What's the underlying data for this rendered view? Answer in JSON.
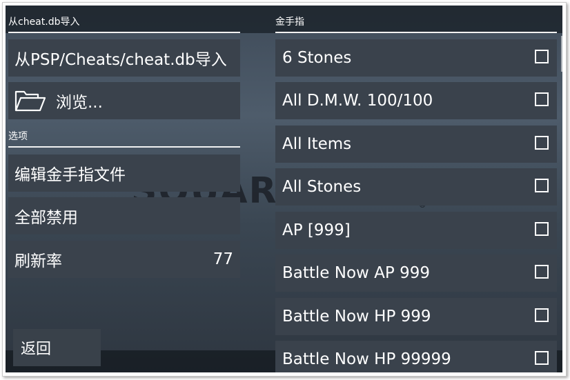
{
  "left": {
    "import_section": {
      "header": "从cheat.db导入",
      "import_button": "从PSP/Cheats/cheat.db导入",
      "browse_button": "浏览..."
    },
    "options_section": {
      "header": "选项",
      "edit_button": "编辑金手指文件",
      "disable_all_button": "全部禁用",
      "refresh_rate": {
        "label": "刷新率",
        "value": "77"
      }
    },
    "back_button": "返回"
  },
  "cheats": {
    "header": "金手指",
    "items": [
      {
        "label": "6 Stones",
        "checked": false
      },
      {
        "label": "All D.M.W. 100/100",
        "checked": false
      },
      {
        "label": "All Items",
        "checked": false
      },
      {
        "label": "All Stones",
        "checked": false
      },
      {
        "label": "AP [999]",
        "checked": false
      },
      {
        "label": "Battle Now AP 999",
        "checked": false
      },
      {
        "label": "Battle Now HP 999",
        "checked": false
      },
      {
        "label": "Battle Now HP 99999",
        "checked": false
      }
    ]
  },
  "background": {
    "watermark": "SQUARE ENIX",
    "watermark_mark": "®"
  },
  "icons": {
    "browse": "folder-icon",
    "checkbox": "checkbox-icon"
  }
}
